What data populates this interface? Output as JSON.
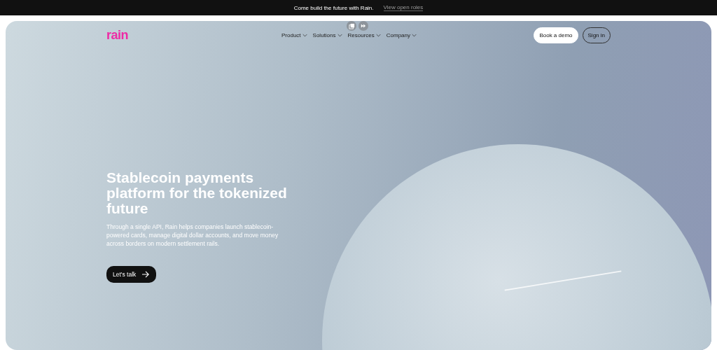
{
  "announcement": {
    "text": "Come build the future with Rain.",
    "link": "View open roles"
  },
  "nav": {
    "logo": "rain",
    "items": [
      {
        "label": "Product"
      },
      {
        "label": "Solutions"
      },
      {
        "label": "Resources"
      },
      {
        "label": "Company"
      }
    ],
    "buttons": [
      {
        "label": "Book a demo",
        "kind": "primary"
      },
      {
        "label": "Sign in",
        "kind": "outline"
      }
    ]
  },
  "hero": {
    "title": "Stablecoin payments platform for the tokenized future",
    "description": "Through a single API, Rain helps companies launch stablecoin-powered cards, manage digital dollar accounts, and move money across borders on modern settlement rails.",
    "cta": "Let's talk"
  }
}
